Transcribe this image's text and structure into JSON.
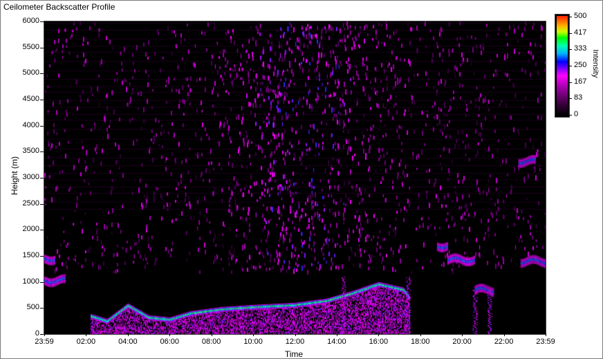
{
  "window": {
    "title": "Ceilometer Backscatter Profile"
  },
  "chart_data": {
    "type": "heatmap",
    "title": "Ceilometer Backscatter Profile",
    "xlabel": "Time",
    "ylabel": "Height (m)",
    "xticks": [
      "23:59",
      "02:00",
      "04:00",
      "06:00",
      "08:00",
      "10:00",
      "12:00",
      "14:00",
      "16:00",
      "18:00",
      "20:00",
      "22:00",
      "23:59"
    ],
    "yticks": [
      "0",
      "500",
      "1000",
      "1500",
      "2000",
      "2500",
      "3000",
      "3500",
      "4000",
      "4500",
      "5000",
      "5500",
      "6000"
    ],
    "ylim": [
      0,
      6000
    ],
    "colorbar": {
      "label": "Intensity",
      "ticks": [
        "0",
        "83",
        "167",
        "250",
        "333",
        "417",
        "500"
      ],
      "range": [
        0,
        500
      ],
      "colors": [
        "#000000",
        "#ff00ff",
        "#0000ff",
        "#00ffff",
        "#00ff00",
        "#ffff00",
        "#ff0000"
      ]
    },
    "features": {
      "boundary_layer_top_m": [
        {
          "hour": 2.2,
          "height": 350
        },
        {
          "hour": 3.0,
          "height": 250
        },
        {
          "hour": 4.0,
          "height": 550
        },
        {
          "hour": 5.0,
          "height": 320
        },
        {
          "hour": 6.0,
          "height": 280
        },
        {
          "hour": 7.0,
          "height": 400
        },
        {
          "hour": 8.5,
          "height": 480
        },
        {
          "hour": 10.0,
          "height": 520
        },
        {
          "hour": 12.0,
          "height": 560
        },
        {
          "hour": 13.5,
          "height": 640
        },
        {
          "hour": 14.7,
          "height": 780
        },
        {
          "hour": 16.0,
          "height": 960
        },
        {
          "hour": 17.2,
          "height": 850
        },
        {
          "hour": 17.5,
          "height": 680
        }
      ],
      "elevated_layers_m": [
        {
          "start_hour": 0.0,
          "end_hour": 0.5,
          "height": 1450
        },
        {
          "start_hour": 0.0,
          "end_hour": 1.0,
          "height": 1030
        },
        {
          "start_hour": 18.8,
          "end_hour": 19.3,
          "height": 1700
        },
        {
          "start_hour": 19.3,
          "end_hour": 20.6,
          "height": 1430
        },
        {
          "start_hour": 20.6,
          "end_hour": 21.5,
          "height": 850
        },
        {
          "start_hour": 22.7,
          "end_hour": 23.5,
          "height": 3320
        },
        {
          "start_hour": 22.8,
          "end_hour": 24.0,
          "height": 1400
        }
      ]
    }
  }
}
